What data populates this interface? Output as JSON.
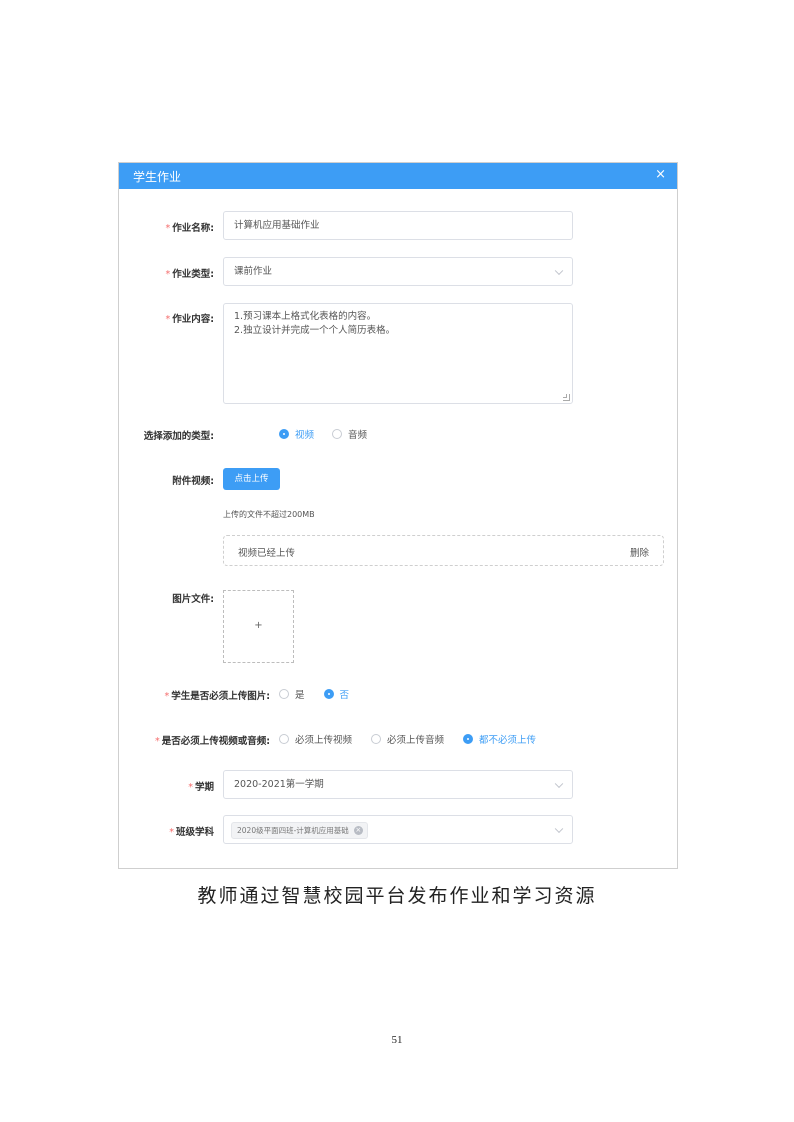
{
  "dialog": {
    "title": "学生作业",
    "close": "×"
  },
  "form": {
    "name": {
      "label": "作业名称:",
      "required": "*",
      "value": "计算机应用基础作业"
    },
    "type": {
      "label": "作业类型:",
      "required": "*",
      "value": "课前作业"
    },
    "content": {
      "label": "作业内容:",
      "required": "*",
      "lines": [
        "1.预习课本上格式化表格的内容。",
        "2.独立设计并完成一个个人简历表格。"
      ]
    },
    "add_type": {
      "label": "选择添加的类型:",
      "options": [
        {
          "label": "视频",
          "checked": true
        },
        {
          "label": "音频",
          "checked": false
        }
      ]
    },
    "attachment": {
      "label": "附件视频:",
      "button": "点击上传",
      "hint": "上传的文件不超过200MB",
      "file_name": "视频已经上传",
      "delete": "删除"
    },
    "image": {
      "label": "图片文件:",
      "plus": "+"
    },
    "must_upload_image": {
      "label": "学生是否必须上传图片:",
      "required": "*",
      "options": [
        {
          "label": "是",
          "checked": false
        },
        {
          "label": "否",
          "checked": true
        }
      ]
    },
    "must_upload_media": {
      "label": "是否必须上传视频或音频:",
      "required": "*",
      "options": [
        {
          "label": "必须上传视频",
          "checked": false
        },
        {
          "label": "必须上传音频",
          "checked": false
        },
        {
          "label": "都不必须上传",
          "checked": true
        }
      ]
    },
    "term": {
      "label": "学期",
      "required": "*",
      "value": "2020-2021第一学期"
    },
    "class_subject": {
      "label": "班级学科",
      "required": "*",
      "tag": "2020级平面四班-计算机应用基础",
      "tag_close": "×"
    }
  },
  "caption": "教师通过智慧校园平台发布作业和学习资源",
  "page_number": "51",
  "colors": {
    "primary": "#3d9df5",
    "required": "#f56c6c"
  }
}
